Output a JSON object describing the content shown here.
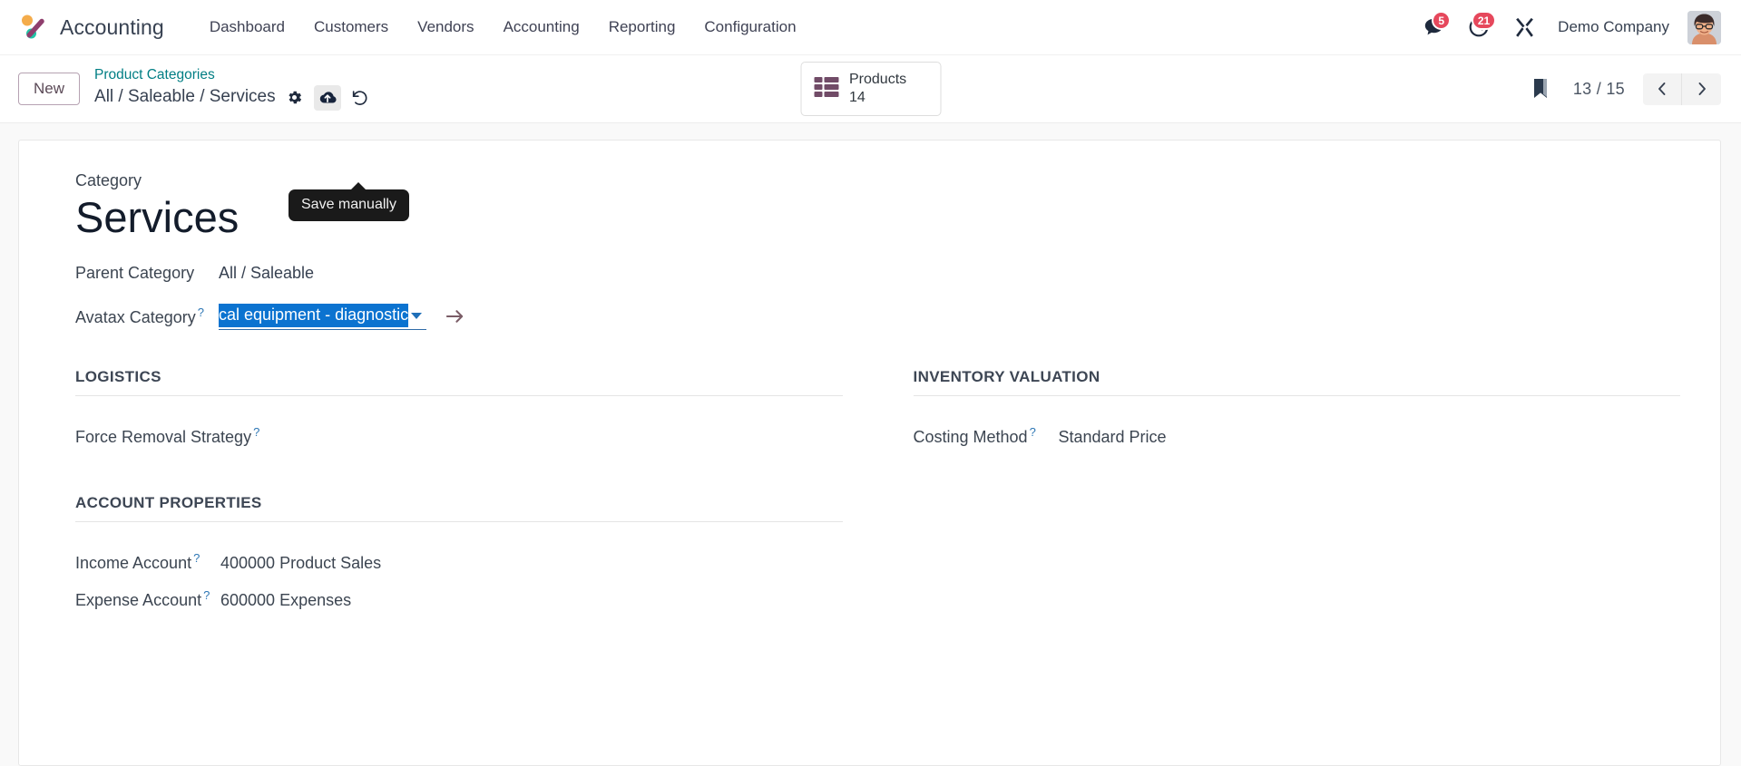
{
  "navbar": {
    "brand": "Accounting",
    "menu": [
      {
        "label": "Dashboard"
      },
      {
        "label": "Customers"
      },
      {
        "label": "Vendors"
      },
      {
        "label": "Accounting"
      },
      {
        "label": "Reporting"
      },
      {
        "label": "Configuration"
      }
    ],
    "messages_badge": "5",
    "activities_badge": "21",
    "company": "Demo Company",
    "icons": {
      "messages": "chat-bubble-icon",
      "activities": "clock-icon",
      "debug": "wrench-icon",
      "avatar": "user-avatar"
    }
  },
  "control_panel": {
    "new_button": "New",
    "breadcrumb_parent": "Product Categories",
    "breadcrumb_current": "All / Saleable / Services",
    "actions": {
      "settings": "gear-icon",
      "save": "cloud-upload-icon",
      "discard": "undo-icon"
    },
    "tooltip": "Save manually",
    "smart_button": {
      "label": "Products",
      "value": "14",
      "icon": "list-grid-icon"
    },
    "pager": {
      "bookmark": "bookmark-icon",
      "count": "13 / 15",
      "previous": "chevron-left-icon",
      "next": "chevron-right-icon"
    }
  },
  "form": {
    "title_label": "Category",
    "title": "Services",
    "parent_category": {
      "label": "Parent Category",
      "value": "All / Saleable"
    },
    "avatax_category": {
      "label": "Avatax Category",
      "help": "?",
      "value": "cal equipment - diagnostic",
      "selected": true,
      "internal_link_icon": "arrow-right-icon"
    },
    "logistics": {
      "title": "Logistics",
      "force_removal_strategy": {
        "label": "Force Removal Strategy",
        "help": "?",
        "value": ""
      }
    },
    "inventory_valuation": {
      "title": "Inventory Valuation",
      "costing_method": {
        "label": "Costing Method",
        "help": "?",
        "value": "Standard Price"
      }
    },
    "account_properties": {
      "title": "Account Properties",
      "income_account": {
        "label": "Income Account",
        "help": "?",
        "value": "400000 Product Sales"
      },
      "expense_account": {
        "label": "Expense Account",
        "help": "?",
        "value": "600000 Expenses"
      }
    }
  },
  "colors": {
    "accent": "#017e84",
    "badge": "#e6485c",
    "selection": "#0b73d0",
    "brand_purple": "#714b67"
  }
}
